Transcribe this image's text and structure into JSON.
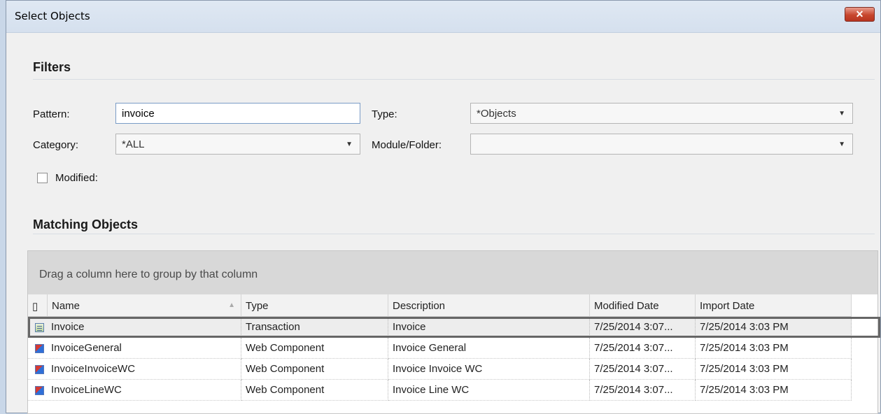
{
  "window": {
    "title": "Select Objects",
    "close_icon": "close-icon"
  },
  "filters": {
    "title": "Filters",
    "pattern_label": "Pattern:",
    "pattern_value": "invoice",
    "type_label": "Type:",
    "type_value": "*Objects",
    "category_label": "Category:",
    "category_value": "*ALL",
    "module_label": "Module/Folder:",
    "module_value": "",
    "modified_label": "Modified:",
    "modified_checked": false
  },
  "matching": {
    "title": "Matching Objects",
    "group_hint": "Drag a column here to group by that column",
    "columns": [
      "Name",
      "Type",
      "Description",
      "Modified Date",
      "Import Date"
    ],
    "rows": [
      {
        "icon": "transaction-icon",
        "name": "Invoice",
        "type": "Transaction",
        "description": "Invoice",
        "modified": "7/25/2014 3:07...",
        "imported": "7/25/2014 3:03 PM",
        "selected": true
      },
      {
        "icon": "web-component-icon",
        "name": "InvoiceGeneral",
        "type": "Web Component",
        "description": "Invoice General",
        "modified": "7/25/2014 3:07...",
        "imported": "7/25/2014 3:03 PM"
      },
      {
        "icon": "web-component-icon",
        "name": "InvoiceInvoiceWC",
        "type": "Web Component",
        "description": "Invoice Invoice WC",
        "modified": "7/25/2014 3:07...",
        "imported": "7/25/2014 3:03 PM"
      },
      {
        "icon": "web-component-icon",
        "name": "InvoiceLineWC",
        "type": "Web Component",
        "description": "Invoice Line WC",
        "modified": "7/25/2014 3:07...",
        "imported": "7/25/2014 3:03 PM"
      }
    ]
  }
}
